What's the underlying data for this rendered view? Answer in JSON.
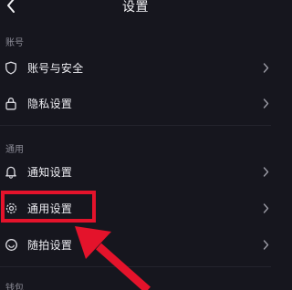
{
  "header": {
    "title": "设置",
    "back_icon": "back-arrow-icon"
  },
  "sections": {
    "account": {
      "title": "账号",
      "items": [
        {
          "label": "账号与安全",
          "icon": "shield-icon"
        },
        {
          "label": "隐私设置",
          "icon": "lock-icon"
        }
      ]
    },
    "general": {
      "title": "通用",
      "items": [
        {
          "label": "通知设置",
          "icon": "bell-icon"
        },
        {
          "label": "通用设置",
          "icon": "gear-icon"
        },
        {
          "label": "随拍设置",
          "icon": "camera-icon"
        }
      ]
    },
    "wallet": {
      "title": "钱包"
    }
  },
  "annotation": {
    "color": "#e4132b",
    "highlighted_item": "通用设置"
  },
  "colors": {
    "background": "#16161e",
    "text": "#ececf1",
    "muted": "#8a8a95"
  }
}
